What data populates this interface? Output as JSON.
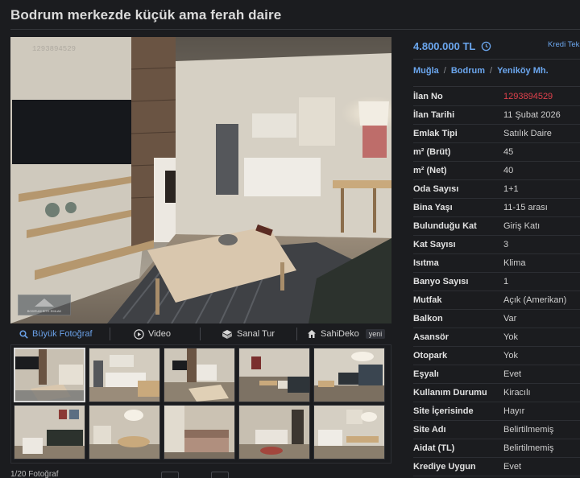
{
  "page": {
    "title": "Bodrum merkezde küçük ama ferah daire"
  },
  "photo": {
    "listing_number_overlay": "1293894529",
    "watermark_text": "BODRUM SITE EMLAK"
  },
  "photo_tools": [
    {
      "label": "Büyük Fotoğraf",
      "icon": "search-icon",
      "active": true
    },
    {
      "label": "Video",
      "icon": "play-icon",
      "active": false
    },
    {
      "label": "Sanal Tur",
      "icon": "virtual-tour-icon",
      "active": false
    },
    {
      "label": "SahiDeko",
      "icon": "home-icon",
      "badge": "yeni",
      "active": false
    }
  ],
  "thumbnails": {
    "count_visible": 10,
    "selected_index": 0
  },
  "pager": {
    "text": "1/20 Fotoğraf"
  },
  "price": {
    "amount": "4.800.000 TL",
    "icon": "history-clock-icon",
    "credit_link": "Kredi Teklifi"
  },
  "breadcrumb": {
    "il": "Muğla",
    "ilce": "Bodrum",
    "mahalle": "Yeniköy Mh."
  },
  "details": [
    {
      "label": "İlan No",
      "value": "1293894529",
      "highlight": true
    },
    {
      "label": "İlan Tarihi",
      "value": "11 Şubat 2026"
    },
    {
      "label": "Emlak Tipi",
      "value": "Satılık Daire"
    },
    {
      "label": "m² (Brüt)",
      "value": "45"
    },
    {
      "label": "m² (Net)",
      "value": "40"
    },
    {
      "label": "Oda Sayısı",
      "value": "1+1"
    },
    {
      "label": "Bina Yaşı",
      "value": "11-15 arası"
    },
    {
      "label": "Bulunduğu Kat",
      "value": "Giriş Katı"
    },
    {
      "label": "Kat Sayısı",
      "value": "3"
    },
    {
      "label": "Isıtma",
      "value": "Klima"
    },
    {
      "label": "Banyo Sayısı",
      "value": "1"
    },
    {
      "label": "Mutfak",
      "value": "Açık (Amerikan)"
    },
    {
      "label": "Balkon",
      "value": "Var"
    },
    {
      "label": "Asansör",
      "value": "Yok"
    },
    {
      "label": "Otopark",
      "value": "Yok"
    },
    {
      "label": "Eşyalı",
      "value": "Evet"
    },
    {
      "label": "Kullanım Durumu",
      "value": "Kiracılı"
    },
    {
      "label": "Site İçerisinde",
      "value": "Hayır"
    },
    {
      "label": "Site Adı",
      "value": "Belirtilmemiş"
    },
    {
      "label": "Aidat (TL)",
      "value": "Belirtilmemiş"
    },
    {
      "label": "Krediye Uygun",
      "value": "Evet"
    }
  ],
  "colors": {
    "background": "#1b1c1f",
    "link": "#6ba6ee",
    "listing_id": "#e0414c",
    "text": "#e6e6e6"
  }
}
